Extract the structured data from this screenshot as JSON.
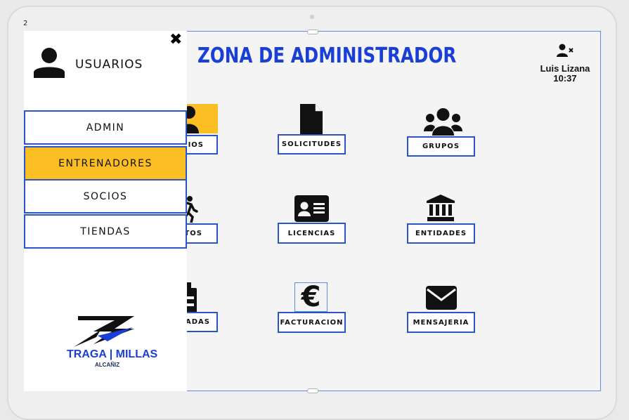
{
  "page_number": "2",
  "header": {
    "title": "ZONA DE ADMINISTRADOR",
    "user_name": "Luis Lizana",
    "time": "10:37",
    "user_icon": "user-x-icon"
  },
  "tiles": [
    {
      "label": "USUARIOS",
      "visible_label": "RIOS",
      "icon": "user-icon"
    },
    {
      "label": "SOLICITUDES",
      "visible_label": "SOLICITUDES",
      "icon": "document-icon"
    },
    {
      "label": "GRUPOS",
      "visible_label": "GRUPOS",
      "icon": "users-group-icon"
    },
    {
      "label": "EVENTOS",
      "visible_label": "TOS",
      "icon": "running-icon"
    },
    {
      "label": "LICENCIAS",
      "visible_label": "LICENCIAS",
      "icon": "id-card-icon"
    },
    {
      "label": "ENTIDADES",
      "visible_label": "ENTIDADES",
      "icon": "bank-icon"
    },
    {
      "label": "ENTRADAS",
      "visible_label": "RADAS",
      "icon": "bottle-icon"
    },
    {
      "label": "FACTURACION",
      "visible_label": "FACTURACION",
      "icon": "euro-icon"
    },
    {
      "label": "MENSAJERIA",
      "visible_label": "MENSAJERIA",
      "icon": "envelope-icon"
    }
  ],
  "drawer": {
    "close_icon": "close-icon",
    "header_icon": "user-icon",
    "header_label": "USUARIOS",
    "items": [
      {
        "label": "ADMIN",
        "active": false
      },
      {
        "label": "ENTRENADORES",
        "active": true
      },
      {
        "label": "SOCIOS",
        "active": false
      },
      {
        "label": "TIENDAS",
        "active": false
      }
    ],
    "logo": {
      "main": "TRAGA | MILLAS",
      "sub": "ALCAÑIZ"
    }
  },
  "colors": {
    "accent": "#1a3fd6",
    "highlight": "#fbbf24",
    "border": "#2a55c8"
  }
}
